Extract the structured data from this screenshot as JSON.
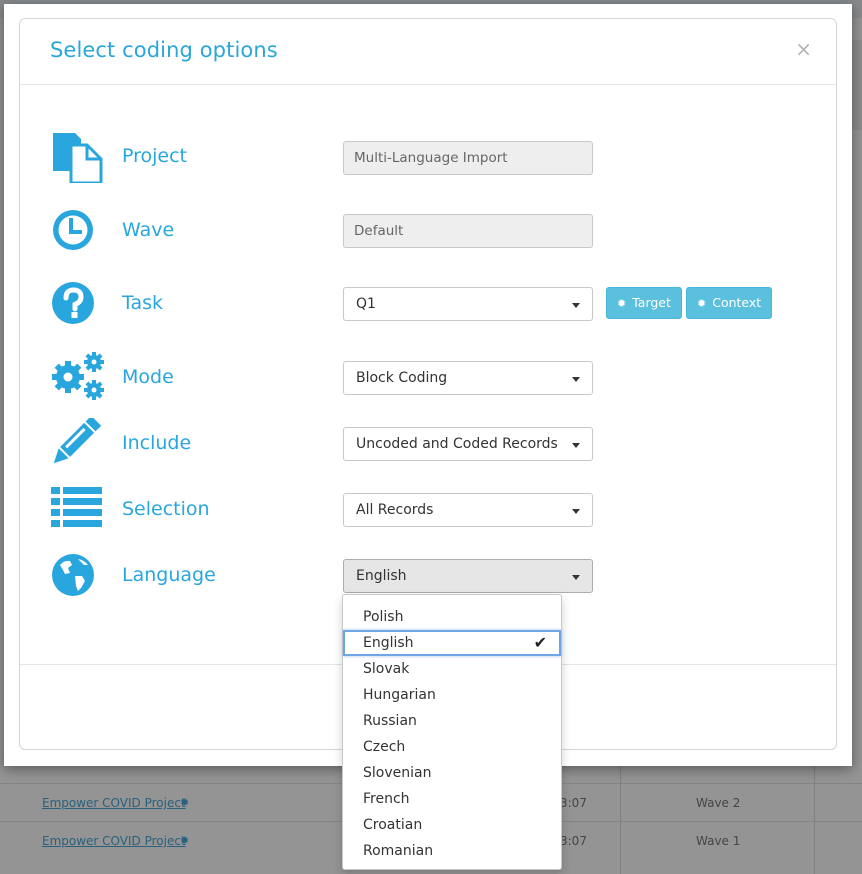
{
  "modal": {
    "title": "Select coding options",
    "close_label": "×"
  },
  "rows": {
    "project": {
      "label": "Project",
      "value": "Multi-Language Import",
      "icon": "document-icon"
    },
    "wave": {
      "label": "Wave",
      "value": "Default",
      "icon": "clock-icon"
    },
    "task": {
      "label": "Task",
      "value": "Q1",
      "icon": "question-icon",
      "target_label": "Target",
      "context_label": "Context"
    },
    "mode": {
      "label": "Mode",
      "value": "Block Coding",
      "icon": "gears-icon"
    },
    "include": {
      "label": "Include",
      "value": "Uncoded and Coded Records",
      "icon": "pencil-icon"
    },
    "selection": {
      "label": "Selection",
      "value": "All Records",
      "icon": "list-icon"
    },
    "language": {
      "label": "Language",
      "value": "English",
      "icon": "globe-icon"
    }
  },
  "language_dropdown": {
    "options": [
      "Polish",
      "English",
      "Slovak",
      "Hungarian",
      "Russian",
      "Czech",
      "Slovenian",
      "French",
      "Croatian",
      "Romanian"
    ],
    "selected": "English",
    "check": "✔"
  },
  "background": {
    "rows": [
      {
        "link": "Empower COVID Project",
        "time": "3:07",
        "wave": "Wave 2"
      },
      {
        "link": "Empower COVID Project",
        "time": "3:07",
        "wave": "Wave 1"
      }
    ]
  },
  "colors": {
    "accent": "#2aa6de",
    "info_button": "#5bc0de"
  }
}
